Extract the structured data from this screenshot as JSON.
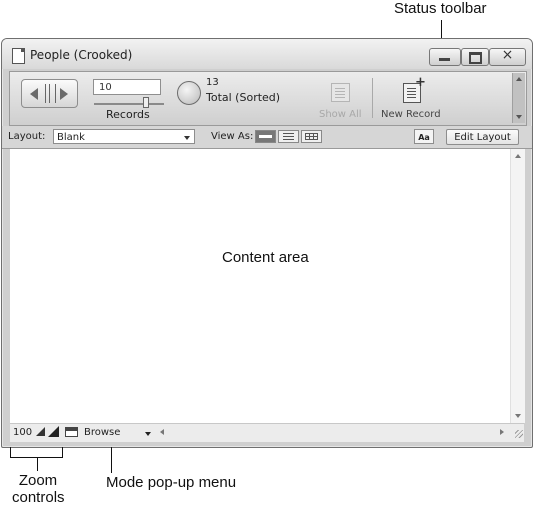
{
  "callouts": {
    "status_toolbar": "Status toolbar",
    "zoom_controls_line1": "Zoom",
    "zoom_controls_line2": "controls",
    "mode_popup": "Mode pop-up menu"
  },
  "window": {
    "title": "People (Crooked)",
    "close_glyph": "×"
  },
  "toolbar": {
    "record_number": "10",
    "records_label": "Records",
    "found_count": "13",
    "found_label": "Total (Sorted)",
    "show_all_label": "Show All",
    "new_record_label": "New Record"
  },
  "layoutbar": {
    "layout_label": "Layout:",
    "layout_value": "Blank",
    "view_as_label": "View As:",
    "format_button": "Aa",
    "edit_layout_label": "Edit Layout"
  },
  "content": {
    "label": "Content area"
  },
  "statusbar": {
    "zoom_percent": "100",
    "mode_value": "Browse"
  }
}
